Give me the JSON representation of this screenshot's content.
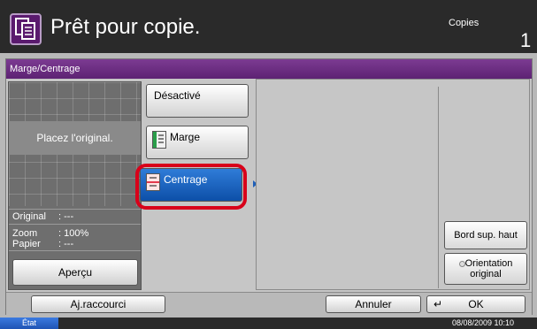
{
  "header": {
    "title": "Prêt pour copie.",
    "copies_label": "Copies",
    "copies_count": "1"
  },
  "window": {
    "title": "Marge/Centrage"
  },
  "preview": {
    "placeholder": "Placez l'original.",
    "info": [
      {
        "label": "Original",
        "value": ": ---"
      },
      {
        "label": "Zoom",
        "value": ": 100%"
      },
      {
        "label": "Papier",
        "value": ": ---"
      }
    ],
    "apercu_label": "Aperçu"
  },
  "options": {
    "desactive": "Désactivé",
    "marge": "Marge",
    "centrage": "Centrage",
    "selected": "Centrage"
  },
  "detail": {
    "bord_label": "Bord sup. haut",
    "orientation_label_1": "Orientation",
    "orientation_label_2": "original"
  },
  "bottom": {
    "shortcut": "Aj.raccourci",
    "cancel": "Annuler",
    "ok": "OK"
  },
  "status": {
    "etat": "État",
    "datetime": "08/08/2009   10:10"
  },
  "colors": {
    "accent": "#5d2273",
    "selected_blue": "#1f5fb8",
    "highlight_red": "#d8001a"
  }
}
